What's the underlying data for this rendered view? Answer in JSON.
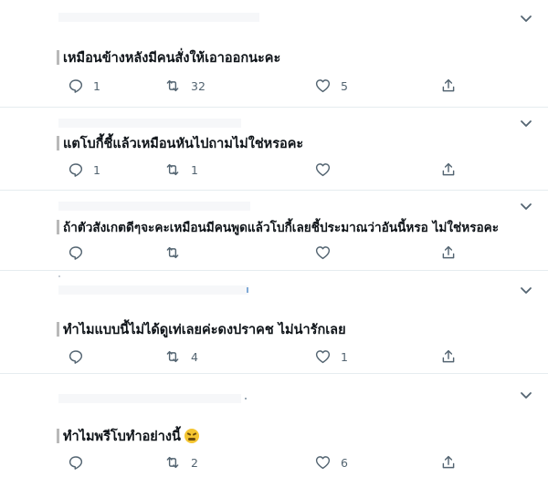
{
  "tweets": [
    {
      "text": "เหมือนข้างหลังมีคนสั่งให้เอาออกนะคะ",
      "reply_count": "1",
      "retweet_count": "32",
      "like_count": "5",
      "has_emoji": false
    },
    {
      "text": "แตโบกี้ชี้แล้วเหมือนหันไปถามไม่ใช่หรอคะ",
      "reply_count": "1",
      "retweet_count": "1",
      "like_count": "",
      "has_emoji": false
    },
    {
      "text": "ถ้าตัวสังเกตดีๆจะคะเหมือนมีคนพูดแล้วโบกี้เลยชี้ประมาณว่าอันนี้หรอ ไม่ใช่หรอคะ",
      "reply_count": "",
      "retweet_count": "",
      "like_count": "",
      "has_emoji": false
    },
    {
      "text": "ทำไมแบบนี้ไม่ได้ดูเท่เลยค่ะดงปราคช ไม่น่ารักเลย",
      "reply_count": "",
      "retweet_count": "4",
      "like_count": "1",
      "has_emoji": false
    },
    {
      "text": "ทำไมพรีโบทำอย่างนี้",
      "reply_count": "",
      "retweet_count": "2",
      "like_count": "6",
      "has_emoji": true,
      "emoji_name": "confounded-face-emoji"
    }
  ],
  "icons": {
    "reply": "reply-icon",
    "retweet": "retweet-icon",
    "like": "heart-icon",
    "share": "share-icon",
    "more": "chevron-down-icon"
  },
  "colors": {
    "icon_gray": "#536471",
    "divider": "#e6ecf0",
    "text": "#0f1419",
    "quote_bar": "#b9b9b9"
  }
}
